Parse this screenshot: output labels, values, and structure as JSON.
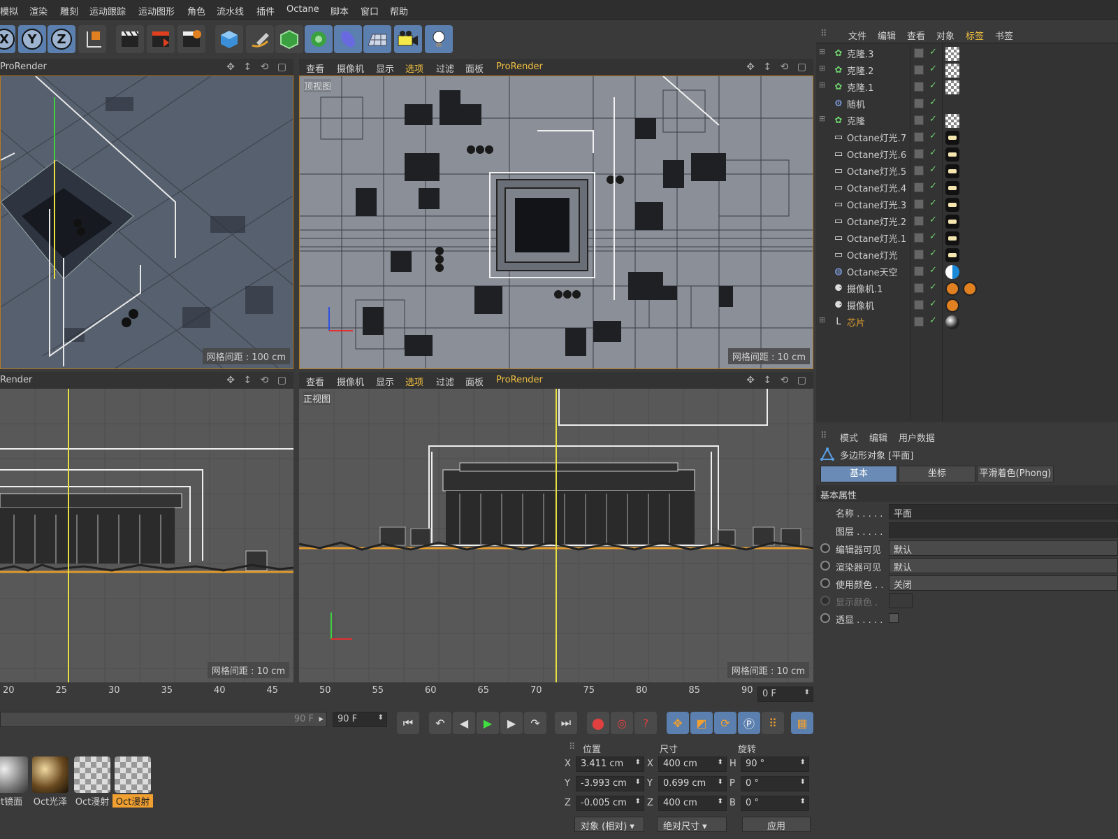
{
  "menu": [
    "模拟",
    "渲染",
    "雕刻",
    "运动跟踪",
    "运动图形",
    "角色",
    "流水线",
    "插件",
    "Octane",
    "脚本",
    "窗口",
    "帮助"
  ],
  "toolbar": {
    "x": "X",
    "y": "Y",
    "z": "Z"
  },
  "viewports": {
    "menu_items": [
      "查看",
      "摄像机",
      "显示",
      "选项",
      "过滤",
      "面板",
      "ProRender"
    ],
    "tl": {
      "bar_label": "ProRender",
      "grid": "网格间距 : 100 cm"
    },
    "tr": {
      "title": "顶视图",
      "grid": "网格间距 : 10 cm"
    },
    "bl": {
      "bar_label": "Render",
      "grid": "网格间距 : 10 cm"
    },
    "br": {
      "title": "正视图",
      "grid": "网格间距 : 10 cm"
    }
  },
  "object_manager": {
    "menu": [
      "文件",
      "编辑",
      "查看",
      "对象",
      "标签",
      "书签"
    ],
    "active_menu": "标签",
    "objects": [
      {
        "name": "克隆.3",
        "icon": "cloner-icon",
        "tag": "checker"
      },
      {
        "name": "克隆.2",
        "icon": "cloner-icon",
        "tag": "checker"
      },
      {
        "name": "克隆.1",
        "icon": "cloner-icon",
        "tag": "checker"
      },
      {
        "name": "随机",
        "icon": "random-effector-icon",
        "tag": ""
      },
      {
        "name": "克隆",
        "icon": "cloner-icon",
        "tag": "checker"
      },
      {
        "name": "Octane灯光.7",
        "icon": "light-icon",
        "tag": "light"
      },
      {
        "name": "Octane灯光.6",
        "icon": "light-icon",
        "tag": "light"
      },
      {
        "name": "Octane灯光.5",
        "icon": "light-icon",
        "tag": "light"
      },
      {
        "name": "Octane灯光.4",
        "icon": "light-icon",
        "tag": "light"
      },
      {
        "name": "Octane灯光.3",
        "icon": "light-icon",
        "tag": "light"
      },
      {
        "name": "Octane灯光.2",
        "icon": "light-icon",
        "tag": "light"
      },
      {
        "name": "Octane灯光.1",
        "icon": "light-icon",
        "tag": "light"
      },
      {
        "name": "Octane灯光",
        "icon": "light-icon",
        "tag": "light"
      },
      {
        "name": "Octane天空",
        "icon": "sky-icon",
        "tag": "sky"
      },
      {
        "name": "摄像机.1",
        "icon": "camera-icon",
        "tag": "camera"
      },
      {
        "name": "摄像机",
        "icon": "camera-icon",
        "tag": "camera"
      },
      {
        "name": "芯片",
        "icon": "null-icon",
        "tag": "sphere"
      }
    ]
  },
  "attribute_manager": {
    "menu": [
      "模式",
      "编辑",
      "用户数据"
    ],
    "object_title": "多边形对象 [平面]",
    "tabs": [
      "基本",
      "坐标",
      "平滑着色(Phong)"
    ],
    "section": "基本属性",
    "props": [
      {
        "label": "名称 . . . . .",
        "value": "平面"
      },
      {
        "label": "图层 . . . . .",
        "value": ""
      },
      {
        "label": "编辑器可见",
        "value": "默认"
      },
      {
        "label": "渲染器可见",
        "value": "默认"
      },
      {
        "label": "使用颜色 . .",
        "value": "关闭"
      },
      {
        "label": "显示颜色 .",
        "value": ""
      },
      {
        "label": "透显 . . . . .",
        "value": ""
      }
    ]
  },
  "timeline": {
    "ticks": [
      "20",
      "25",
      "30",
      "35",
      "40",
      "45",
      "50",
      "55",
      "60",
      "65",
      "70",
      "75",
      "80",
      "85",
      "90"
    ],
    "current_frame": "0 F",
    "slider_end": "90 F",
    "end_field": "90 F"
  },
  "materials": [
    "ct镜面",
    "Oct光泽",
    "Oct漫射",
    "Oct漫射"
  ],
  "coordinates": {
    "headers": [
      "位置",
      "尺寸",
      "旋转"
    ],
    "position": [
      {
        "axis": "X",
        "value": "3.411 cm"
      },
      {
        "axis": "Y",
        "value": "-3.993 cm"
      },
      {
        "axis": "Z",
        "value": "-0.005 cm"
      }
    ],
    "size": [
      {
        "axis": "X",
        "value": "400 cm"
      },
      {
        "axis": "Y",
        "value": "0.699 cm"
      },
      {
        "axis": "Z",
        "value": "400 cm"
      }
    ],
    "rotation": [
      {
        "axis": "H",
        "value": "90 °"
      },
      {
        "axis": "P",
        "value": "0 °"
      },
      {
        "axis": "B",
        "value": "0 °"
      }
    ],
    "mode_select": "对象 (相对)",
    "size_select": "绝对尺寸",
    "apply_label": "应用"
  },
  "colors": {
    "accent": "#f0c040",
    "selected": "#5b7fae",
    "panel": "#3a3a3a"
  }
}
